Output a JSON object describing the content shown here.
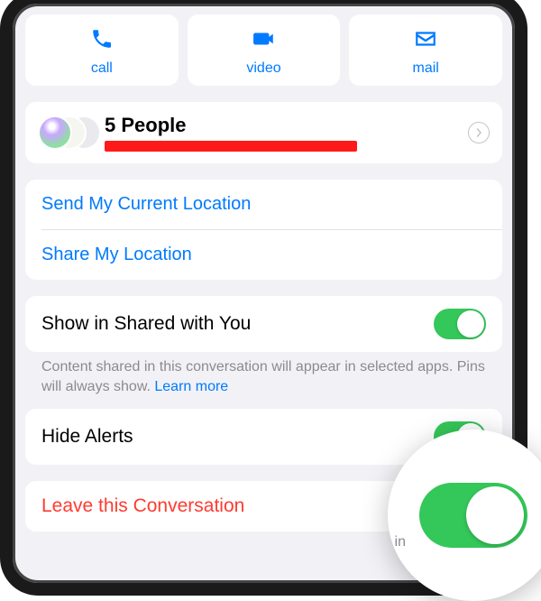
{
  "actions": {
    "call": "call",
    "video": "video",
    "mail": "mail"
  },
  "people": {
    "title": "5 People"
  },
  "location": {
    "send_current": "Send My Current Location",
    "share": "Share My Location"
  },
  "shared": {
    "toggle_label": "Show in Shared with You",
    "helper": "Content shared in this conversation will appear in selected apps. Pins will always show. ",
    "learn_more": "Learn more",
    "state": true
  },
  "alerts": {
    "label": "Hide Alerts",
    "state": true
  },
  "leave": {
    "label": "Leave this Conversation"
  },
  "magnifier_hint": "in"
}
